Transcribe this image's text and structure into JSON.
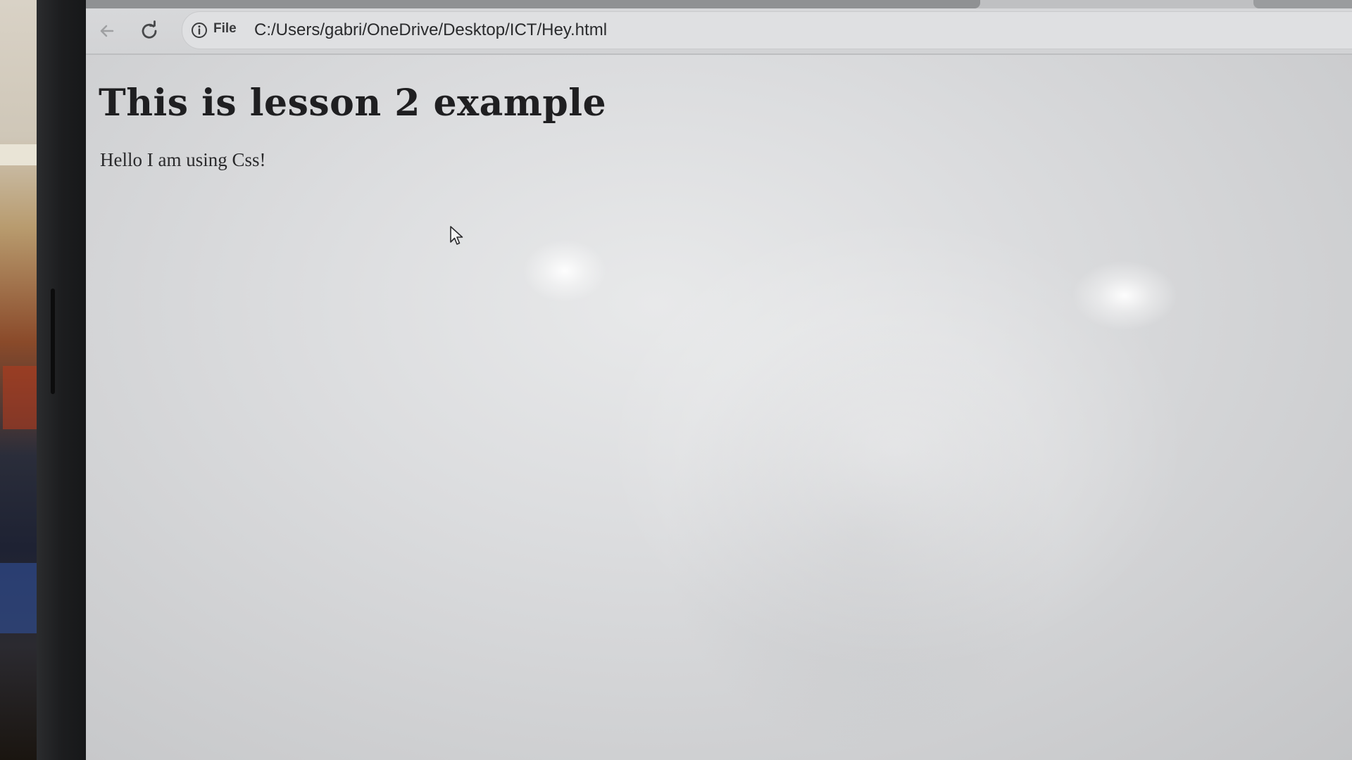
{
  "browser": {
    "address_bar": {
      "scheme_label": "File",
      "url": "C:/Users/gabri/OneDrive/Desktop/ICT/Hey.html"
    },
    "icons": {
      "back": "back-arrow-icon",
      "reload": "reload-icon",
      "info": "info-icon",
      "cursor": "mouse-cursor-icon"
    }
  },
  "page": {
    "heading": "This is lesson 2 example",
    "paragraph": "Hello I am using Css!"
  },
  "colors": {
    "page_background": "#dcdddf",
    "heading_text": "#1f1f21",
    "toolbar": "#d7d8da"
  }
}
